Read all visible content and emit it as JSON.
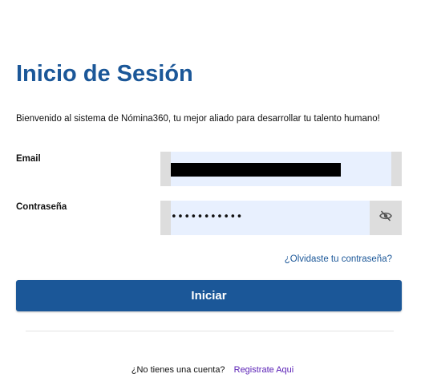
{
  "title": "Inicio de Sesión",
  "welcome": "Bienvenido al sistema de Nómina360, tu mejor aliado para desarrollar tu talento humano!",
  "email": {
    "label": "Email",
    "value": ""
  },
  "password": {
    "label": "Contraseña",
    "masked_value": "•••••••••••",
    "toggle_icon": "eye-off-icon"
  },
  "forgot_link": "¿Olvidaste tu contraseña?",
  "login_button": "Iniciar",
  "register": {
    "question": "¿No tienes una cuenta?",
    "link": "Registrate Aqui"
  },
  "colors": {
    "primary": "#1b5798",
    "field_bg": "#e8f0fe",
    "field_border": "#dddddd",
    "link_purple": "#5b21b6"
  }
}
